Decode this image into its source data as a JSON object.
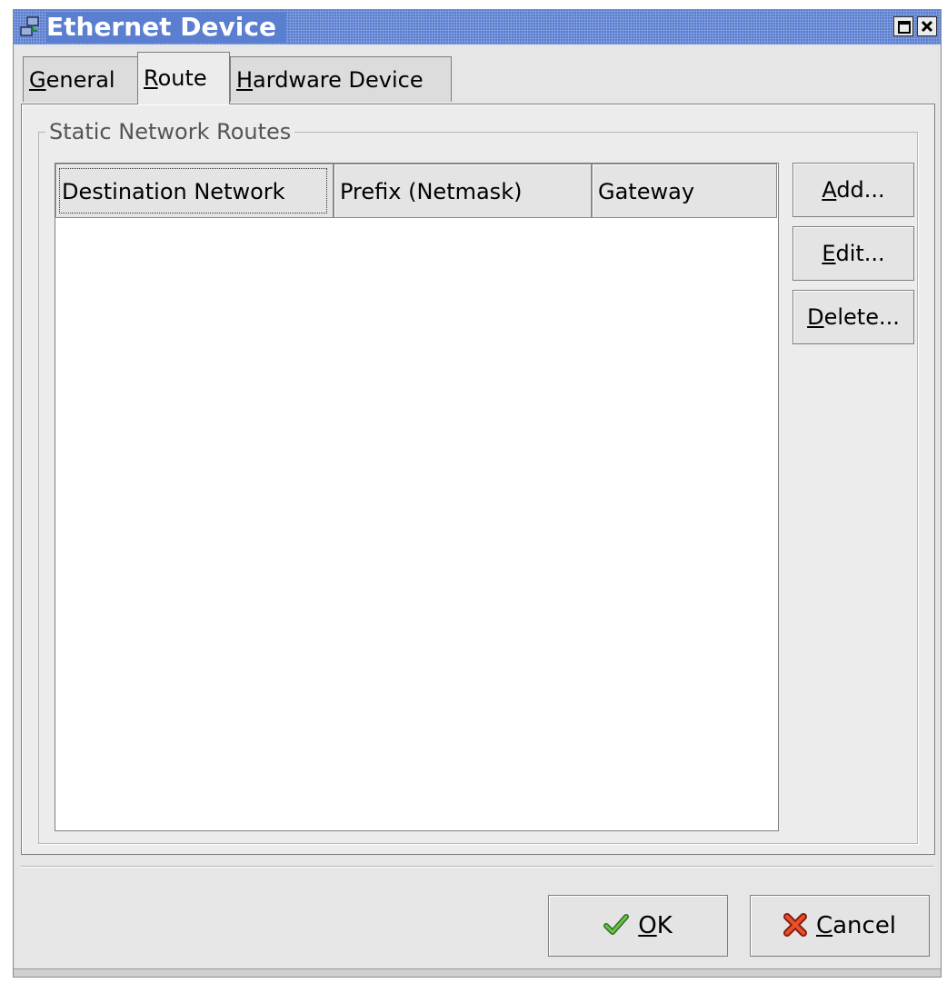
{
  "window": {
    "title": "Ethernet Device"
  },
  "tabs": [
    {
      "label": "General",
      "mnemonic": "G",
      "rest": "eneral",
      "active": false
    },
    {
      "label": "Route",
      "mnemonic": "R",
      "rest": "oute",
      "active": true
    },
    {
      "label": "Hardware Device",
      "mnemonic": "H",
      "rest": "ardware Device",
      "active": false
    }
  ],
  "routes_frame": {
    "label": "Static Network Routes",
    "columns": [
      "Destination Network",
      "Prefix (Netmask)",
      "Gateway"
    ],
    "rows": []
  },
  "side_buttons": {
    "add": {
      "label": "Add...",
      "mnemonic": "A",
      "rest": "dd..."
    },
    "edit": {
      "label": "Edit...",
      "mnemonic": "E",
      "rest": "dit..."
    },
    "delete": {
      "label": "Delete...",
      "mnemonic": "D",
      "rest": "elete..."
    }
  },
  "dialog_buttons": {
    "ok": {
      "label": "OK",
      "mnemonic": "O",
      "rest": "K",
      "icon": "checkmark-icon",
      "icon_color": "#3a8a2e"
    },
    "cancel": {
      "label": "Cancel",
      "mnemonic": "C",
      "rest": "ancel",
      "icon": "cross-icon",
      "icon_color": "#d84020"
    }
  }
}
